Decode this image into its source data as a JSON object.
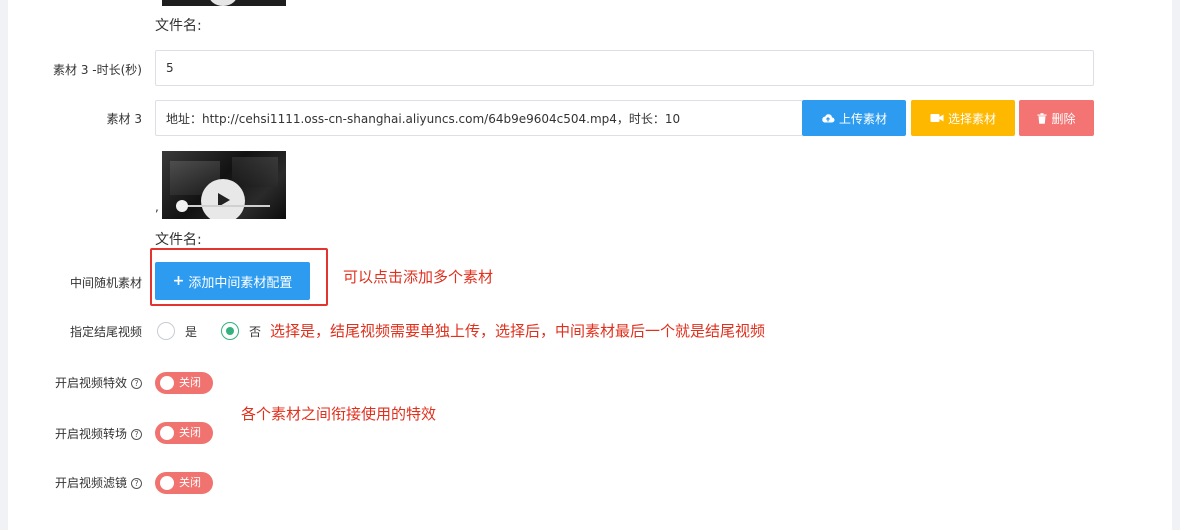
{
  "material_top": {
    "filename_label": "文件名:"
  },
  "duration_row": {
    "label": "素材 3 -时长(秒)",
    "value": "5"
  },
  "material_row": {
    "label": "素材 3",
    "address_value": "地址：http://cehsi1111.oss-cn-shanghai.aliyuncs.com/64b9e9604c504.mp4，时长：10",
    "upload_label": "上传素材",
    "choose_label": "选择素材",
    "delete_label": "删除",
    "separator": ",",
    "filename_label": "文件名:"
  },
  "middle_row": {
    "label": "中间随机素材",
    "add_button_label": "添加中间素材配置",
    "annotation": "可以点击添加多个素材"
  },
  "ending_row": {
    "label": "指定结尾视频",
    "option_yes": "是",
    "option_no": "否",
    "selected": "否",
    "annotation": "选择是，结尾视频需要单独上传，选择后，中间素材最后一个就是结尾视频"
  },
  "effects_row": {
    "label": "开启视频特效",
    "switch_label": "关闭",
    "annotation": "各个素材之间衔接使用的特效"
  },
  "transition_row": {
    "label": "开启视频转场",
    "switch_label": "关闭"
  },
  "filter_row": {
    "label": "开启视频滤镜",
    "switch_label": "关闭"
  },
  "colors": {
    "primary_blue": "#2d9cf0",
    "warning_yellow": "#ffb800",
    "danger_red": "#f47373",
    "switch_off": "#f07370",
    "radio_checked": "#34b27d",
    "annotation_red": "#e0301e"
  },
  "icons": {
    "upload": "cloud-upload-icon",
    "choose": "video-camera-icon",
    "delete": "trash-icon",
    "add": "plus-icon",
    "help": "question-circle-icon",
    "play": "play-icon"
  }
}
